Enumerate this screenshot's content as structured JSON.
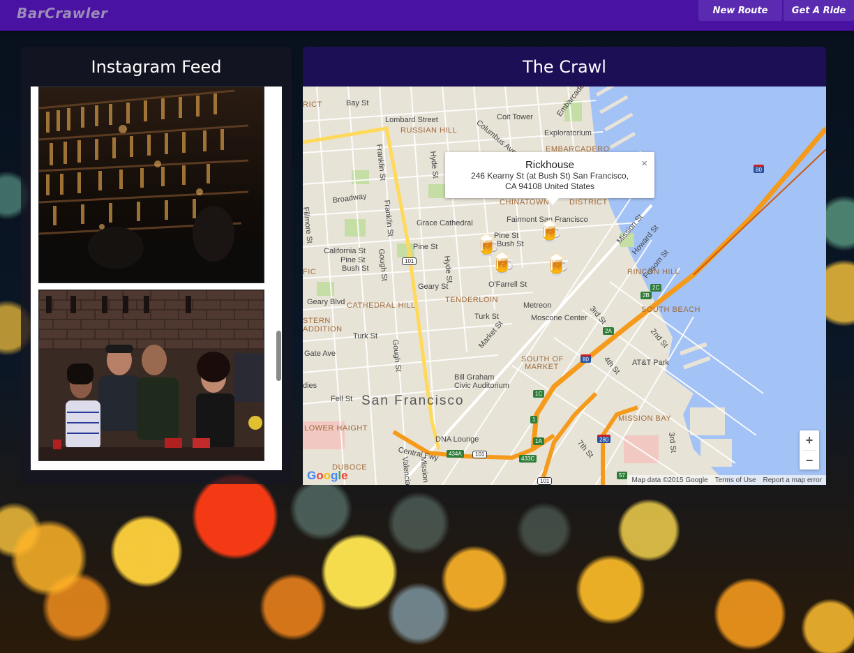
{
  "app": {
    "brand": "BarCrawler"
  },
  "nav": {
    "new_route": "New Route",
    "get_ride": "Get A Ride"
  },
  "feed": {
    "title": "Instagram Feed"
  },
  "crawl": {
    "title": "The Crawl"
  },
  "map": {
    "infowindow": {
      "title": "Rickhouse",
      "address_line1": "246 Kearny St (at Bush St) San Francisco,",
      "address_line2": "CA 94108 United States",
      "close": "×"
    },
    "labels": {
      "bay_st": "Bay St",
      "lombard_st": "Lombard Street",
      "russian_hill": "RUSSIAN HILL",
      "coit_tower": "Coit Tower",
      "exploratorium": "Exploratorium",
      "embarcadero_district": "EMBARCADERO",
      "embarcadero_st": "Embarcadero",
      "columbus_ave": "Columbus Ave",
      "broadway": "Broadway",
      "franklin_st_1": "Franklin St",
      "franklin_st_2": "Franklin St",
      "hyde_st_1": "Hyde St",
      "hyde_st_2": "Hyde St",
      "chinatown": "CHINATOWN",
      "district": "DISTRICT",
      "grace_cathedral": "Grace Cathedral",
      "fairmont": "Fairmont San Francisco",
      "pine_st_1": "Pine St",
      "pine_st_2": "Pine St",
      "pine_st_3": "Pine St",
      "bush_st_1": "Bush St",
      "bush_st_2": "Bush St",
      "california_st": "California St",
      "fillmore_st": "Fillmore St",
      "gough_st_1": "Gough St",
      "gough_st_2": "Gough St",
      "geary_st": "Geary St",
      "geary_blvd": "Geary Blvd",
      "ofarrell_st": "O'Farrell St",
      "cathedral_hill": "CATHEDRAL HILL",
      "tenderloin": "TENDERLOIN",
      "metreon": "Metreon",
      "moscone": "Moscone Center",
      "turk_st_1": "Turk St",
      "turk_st_2": "Turk St",
      "market_st": "Market St",
      "south_of_market_1": "SOUTH OF",
      "south_of_market_2": "MARKET",
      "bill_graham_1": "Bill Graham",
      "bill_graham_2": "Civic Auditorium",
      "san_francisco": "San Francisco",
      "fell_st": "Fell St",
      "lower_haight": "LOWER HAIGHT",
      "dna_lounge": "DNA Lounge",
      "central_fwy": "Central Fwy",
      "rincon_hill": "RINCON HILL",
      "south_beach": "SOUTH BEACH",
      "mission_st": "Mission St",
      "howard_st": "Howard St",
      "folsom_st": "Folsom St",
      "third_st_1": "3rd St",
      "third_st_2": "3rd St",
      "second_st": "2nd St",
      "fourth_st": "4th St",
      "seventh_st": "7th St",
      "att_park": "AT&T Park",
      "mission_bay": "MISSION BAY",
      "gate_ave": "Gate Ave",
      "stern_addition_1": "STERN",
      "stern_addition_2": "ADDITION",
      "fic": "FIC",
      "dies": "dies",
      "rict": "RICT",
      "duboce": "DUBOCE",
      "valencia": "Valencia",
      "mission": "Mission",
      "s_st": "St"
    },
    "shields": {
      "us101_a": "101",
      "us101_b": "101",
      "us101_c": "101",
      "i80_a": "80",
      "i80_b": "80",
      "i280": "280",
      "r434a": "434A",
      "r433c": "433C",
      "r1a": "1A",
      "r1c": "1C",
      "r1": "1",
      "r2a": "2A",
      "r2b": "2B",
      "r2c": "2C",
      "r57": "57"
    },
    "zoom_in": "+",
    "zoom_out": "−",
    "attribution": {
      "data": "Map data ©2015 Google",
      "terms": "Terms of Use",
      "report": "Report a map error"
    },
    "logo": "Google"
  }
}
